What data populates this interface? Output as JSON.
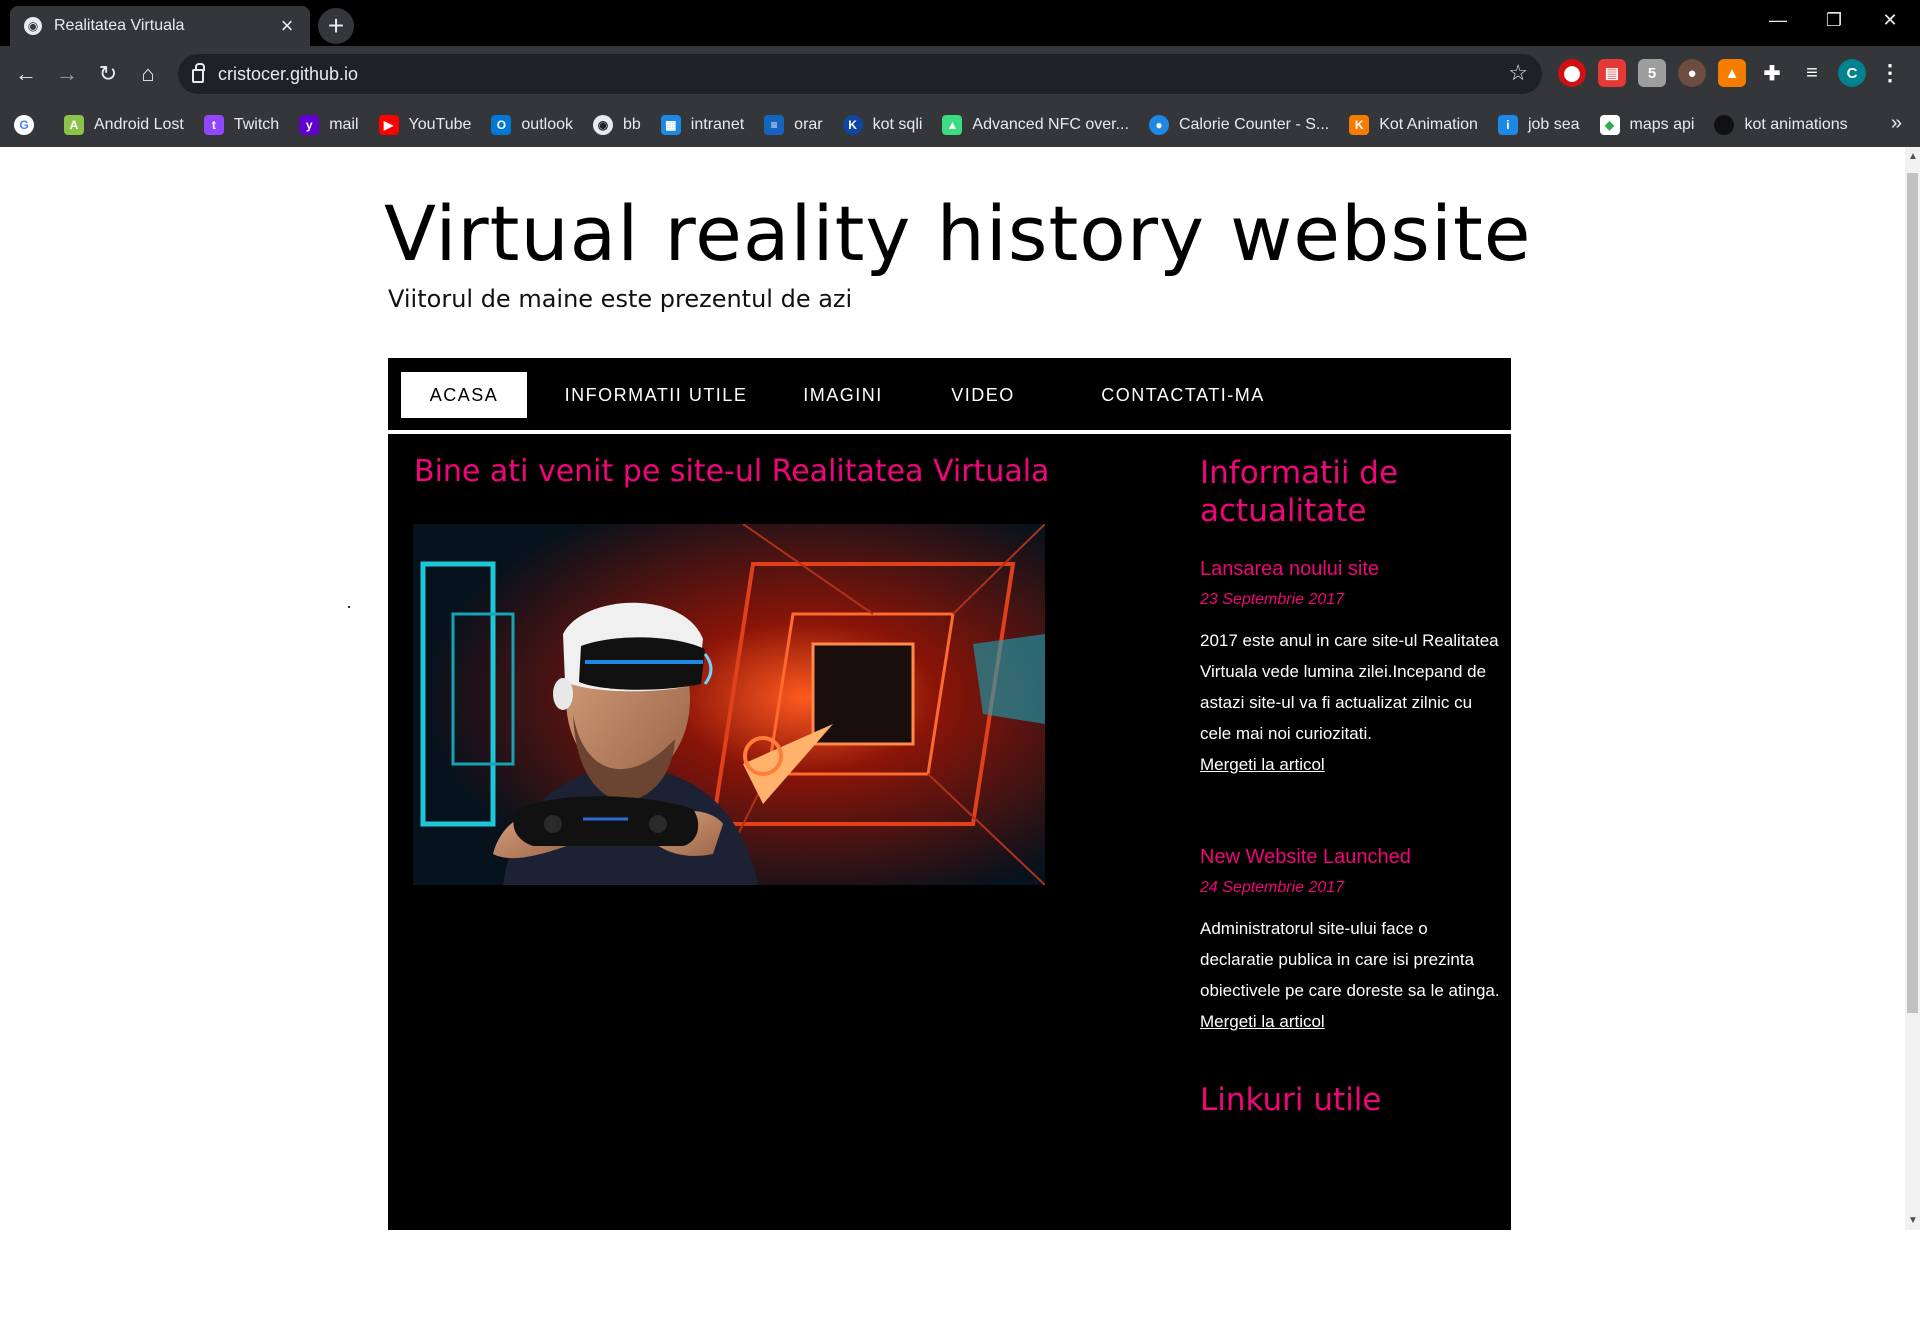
{
  "browser": {
    "tab_title": "Realitatea Virtuala",
    "url": "cristocer.github.io",
    "bookmarks": [
      "Android Lost",
      "Twitch",
      "mail",
      "YouTube",
      "outlook",
      "bb",
      "intranet",
      "orar",
      "kot sqli",
      "Advanced NFC over...",
      "Calorie Counter - S...",
      "Kot Animation",
      "job sea",
      "maps api",
      "kot animations"
    ],
    "profile_initial": "C"
  },
  "site": {
    "title": "Virtual reality history website",
    "tagline": "Viitorul de maine este prezentul de azi",
    "nav": [
      "ACASA",
      "INFORMATII UTILE",
      "IMAGINI",
      "VIDEO",
      "CONTACTATI-MA"
    ],
    "welcome": "Bine ati venit pe site-ul Realitatea Virtuala",
    "sidebar": {
      "heading": "Informatii de actualitate",
      "articles": [
        {
          "title": "Lansarea noului site",
          "date": "23 Septembrie 2017",
          "body": "2017 este anul in care site-ul Realitatea Virtuala vede lumina zilei.Incepand de astazi site-ul va fi actualizat zilnic cu cele mai noi curiozitati.",
          "link": "Mergeti la articol"
        },
        {
          "title": "New Website Launched",
          "date": "24 Septembrie 2017",
          "body": "Administratorul site-ului face o declaratie publica in care isi prezinta obiectivele pe care doreste sa le atinga.",
          "link": "Mergeti la articol"
        }
      ],
      "links_heading": "Linkuri utile"
    }
  },
  "colors": {
    "accent": "#f0057a",
    "nav_bg": "#000000"
  }
}
